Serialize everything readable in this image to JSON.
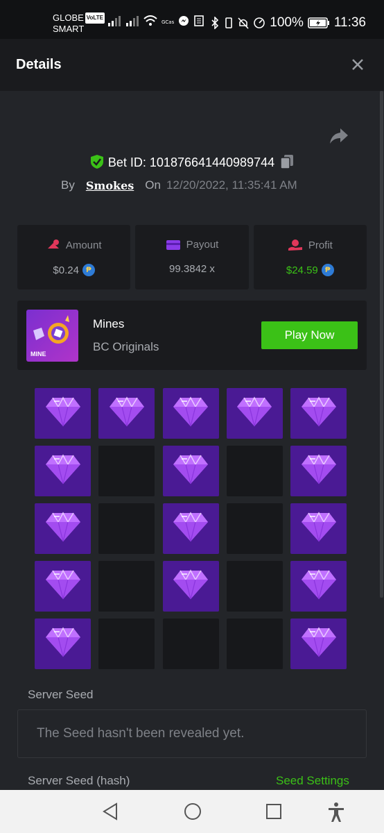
{
  "status_bar": {
    "carrier_line1": "GLOBE",
    "volte": "VoLTE",
    "carrier_line2": "SMART",
    "battery": "100%",
    "time": "11:36"
  },
  "header": {
    "title": "Details"
  },
  "bet": {
    "id_text": "Bet ID: 101876641440989744",
    "by_label": "By",
    "user": "Smokes",
    "on_label": "On",
    "date": "12/20/2022, 11:35:41 AM"
  },
  "stats": {
    "amount": {
      "label": "Amount",
      "value": "$0.24"
    },
    "payout": {
      "label": "Payout",
      "value": "99.3842 x"
    },
    "profit": {
      "label": "Profit",
      "value": "$24.59"
    }
  },
  "game": {
    "name": "Mines",
    "provider": "BC Originals",
    "thumb_text": "MINE",
    "play_label": "Play Now"
  },
  "board": {
    "rows": [
      [
        "gem",
        "gem",
        "gem",
        "gem",
        "gem"
      ],
      [
        "gem",
        "empty",
        "gem",
        "empty",
        "gem"
      ],
      [
        "gem",
        "empty",
        "gem",
        "empty",
        "gem"
      ],
      [
        "gem",
        "empty",
        "gem",
        "empty",
        "gem"
      ],
      [
        "gem",
        "empty",
        "empty",
        "empty",
        "gem"
      ]
    ]
  },
  "seeds": {
    "server_seed_label": "Server Seed",
    "server_seed_value": "The Seed hasn't been revealed yet.",
    "hash_label": "Server Seed (hash)",
    "settings_link": "Seed Settings"
  },
  "colors": {
    "accent_green": "#3bc117",
    "gem_cell": "#4a1a94",
    "empty_cell": "#17181b"
  },
  "icons": {
    "share": "share-icon",
    "close": "close-icon",
    "verified": "shield-check-icon",
    "copy": "copy-icon",
    "coin": "peso-coin-icon",
    "gem": "diamond-icon"
  }
}
